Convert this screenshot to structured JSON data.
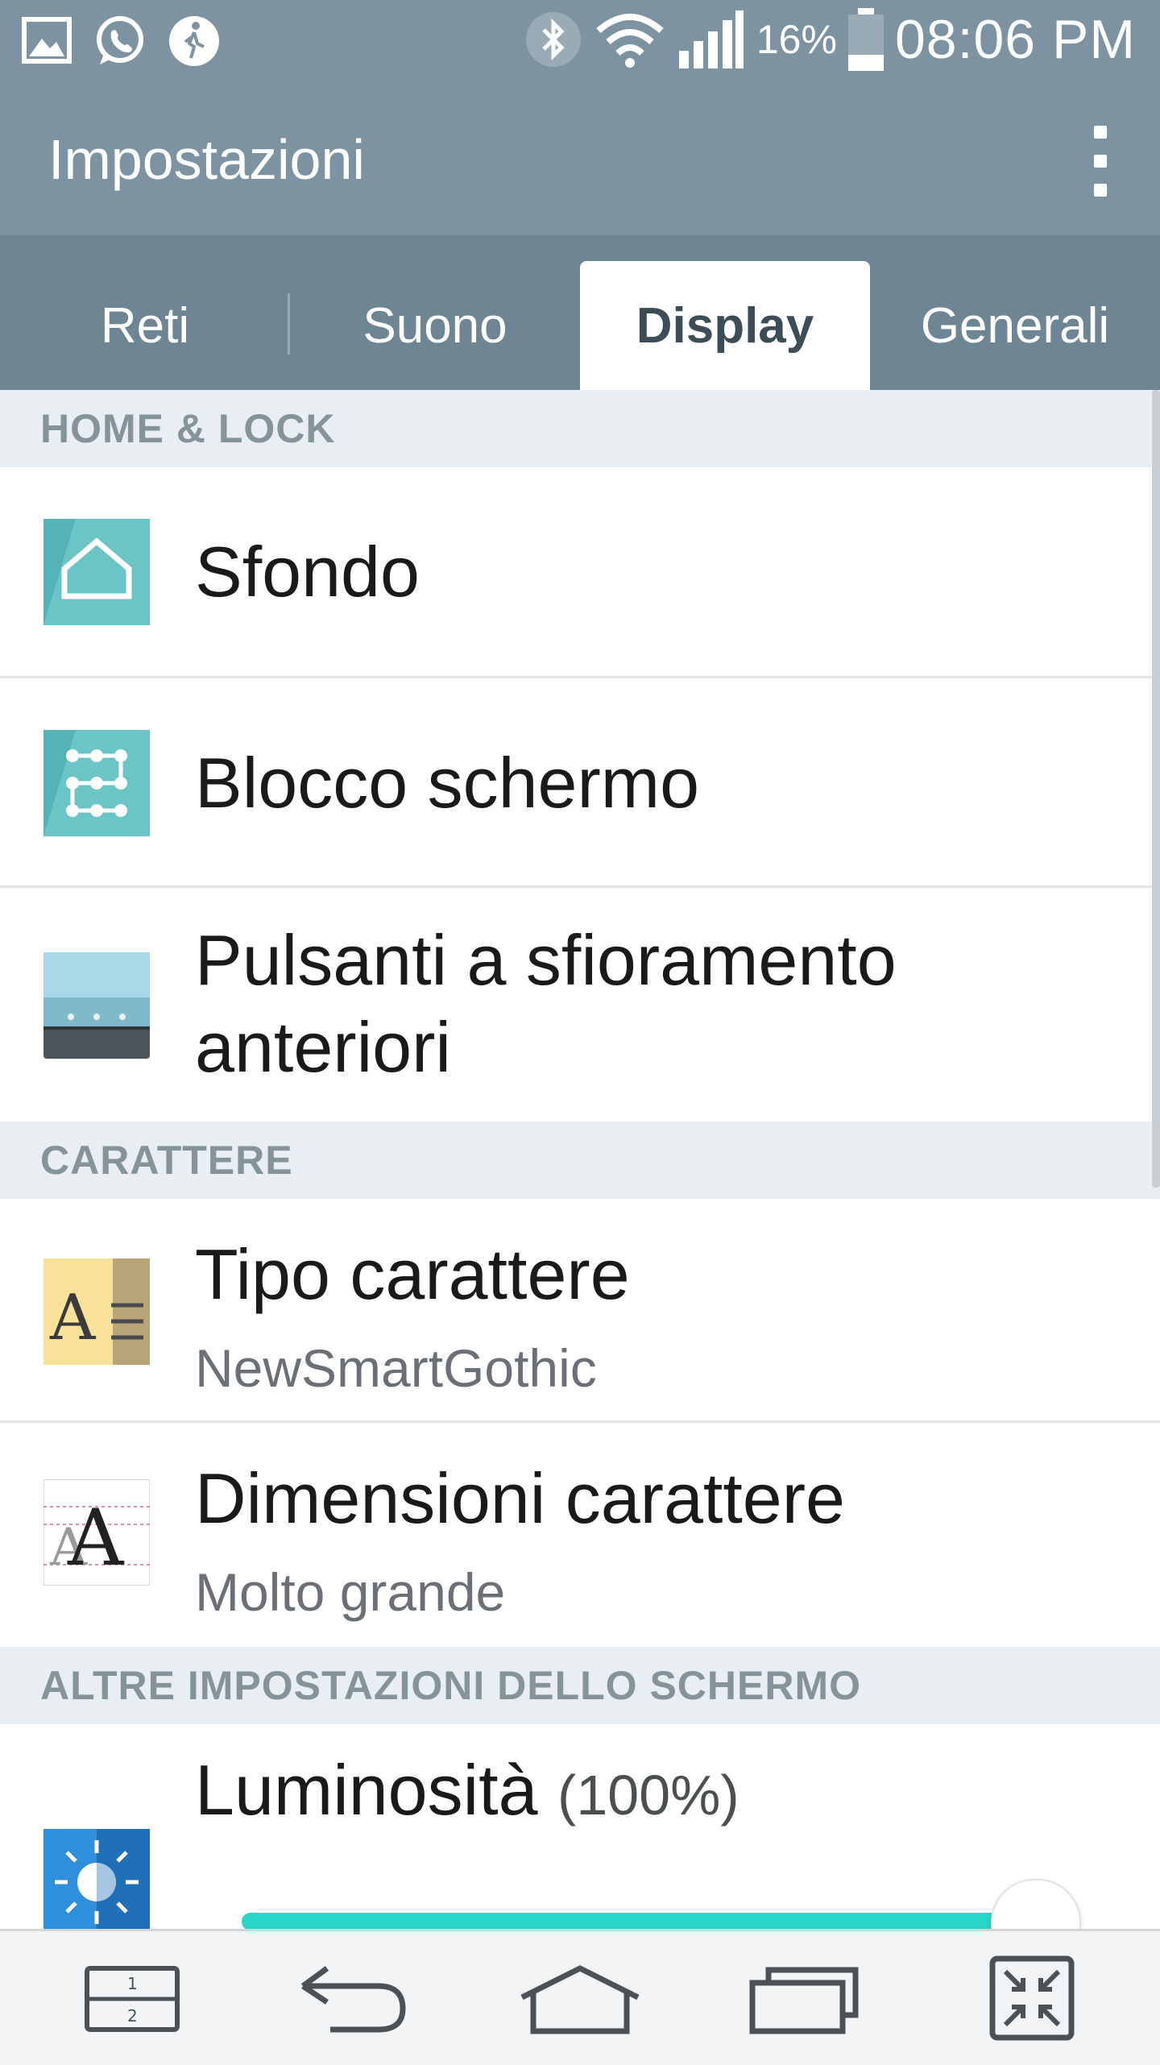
{
  "status_bar": {
    "icons_left": [
      "gallery-icon",
      "whatsapp-icon",
      "walk-icon"
    ],
    "icons_right": [
      "bluetooth-icon",
      "wifi-icon",
      "signal-icon"
    ],
    "battery_percent": "16%",
    "time": "08:06 PM"
  },
  "app_bar": {
    "title": "Impostazioni",
    "menu_icon": "overflow-menu-icon"
  },
  "tabs": [
    {
      "label": "Reti",
      "active": false
    },
    {
      "label": "Suono",
      "active": false
    },
    {
      "label": "Display",
      "active": true
    },
    {
      "label": "Generali",
      "active": false
    }
  ],
  "sections": [
    {
      "header": "HOME & LOCK",
      "items": [
        {
          "title": "Sfondo",
          "icon": "wallpaper-home-icon"
        },
        {
          "title": "Blocco schermo",
          "icon": "lock-pattern-icon"
        },
        {
          "title": "Pulsanti a sfioramento anteriori",
          "title_line1": "Pulsanti a sfioramento",
          "title_line2": "anteriori",
          "icon": "touch-buttons-icon"
        }
      ]
    },
    {
      "header": "CARATTERE",
      "items": [
        {
          "title": "Tipo carattere",
          "subtitle": "NewSmartGothic",
          "icon": "font-type-icon"
        },
        {
          "title": "Dimensioni carattere",
          "subtitle": "Molto grande",
          "icon": "font-size-icon"
        }
      ]
    },
    {
      "header": "ALTRE IMPOSTAZIONI DELLO SCHERMO",
      "items": [
        {
          "title": "Luminosità",
          "value": "(100%)",
          "icon": "brightness-icon",
          "slider_fraction": 1.0
        }
      ]
    }
  ],
  "nav_bar": {
    "buttons": [
      "dual-window-icon",
      "back-icon",
      "home-icon",
      "recent-apps-icon",
      "mini-view-icon"
    ],
    "dual_window_top": "1",
    "dual_window_bottom": "2"
  },
  "colors": {
    "primary": "#7d93a1",
    "tab_bar": "#6e8593",
    "accent_teal": "#2bd4c9"
  }
}
